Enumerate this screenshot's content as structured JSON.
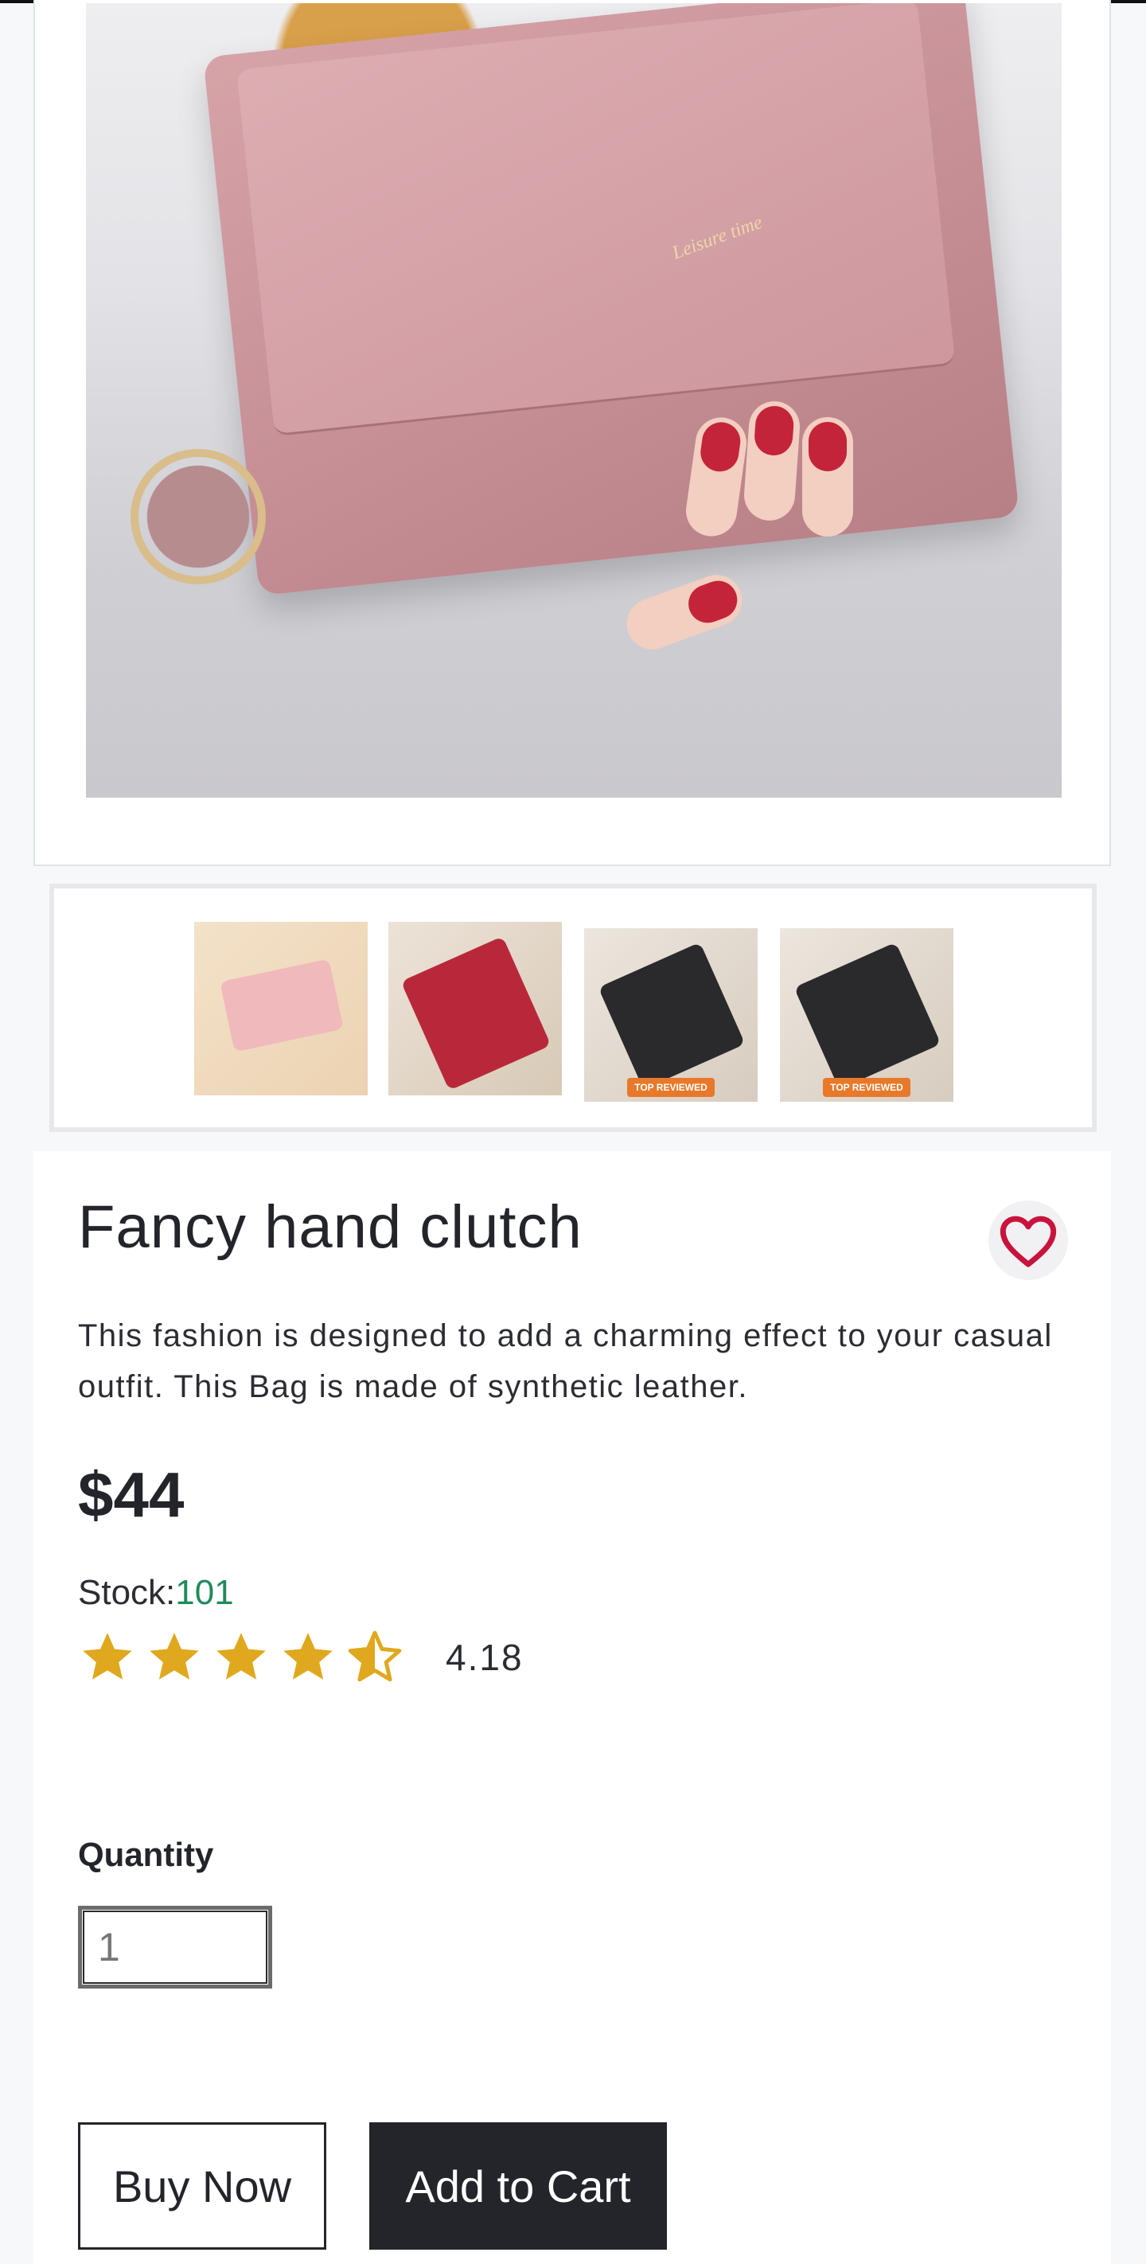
{
  "product": {
    "title": "Fancy hand clutch",
    "description": "This fashion is designed to add a charming effect to your casual outfit. This Bag is made of synthetic leather.",
    "price": "$44",
    "stock_label": "Stock:",
    "stock_value": "101",
    "rating": 4.18,
    "rating_text": "4.18",
    "wallet_logo_text": "Leisure time"
  },
  "gallery": {
    "thumbnails": [
      {
        "name": "pink wallet",
        "badge": ""
      },
      {
        "name": "red wallet",
        "badge": ""
      },
      {
        "name": "black wallet",
        "badge": "TOP REVIEWED"
      },
      {
        "name": "black wallet",
        "badge": "TOP REVIEWED"
      }
    ]
  },
  "quantity": {
    "label": "Quantity",
    "value": "1"
  },
  "actions": {
    "buy_now": "Buy Now",
    "add_to_cart": "Add to Cart"
  },
  "icons": {
    "wishlist": "heart-icon",
    "star": "star-icon"
  },
  "colors": {
    "accent_heart": "#c8143c",
    "star": "#e0a81e",
    "stock": "#1f8a5c",
    "dark": "#23252b"
  }
}
